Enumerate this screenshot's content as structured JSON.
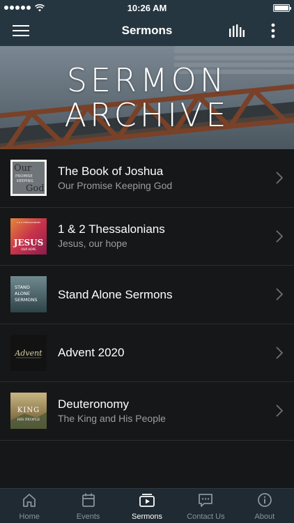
{
  "status_bar": {
    "time": "10:26 AM"
  },
  "nav": {
    "title": "Sermons"
  },
  "banner": {
    "line1": "SERMON",
    "line2": "ARCHIVE"
  },
  "sermons": [
    {
      "title": "The Book of Joshua",
      "subtitle": "Our Promise Keeping God",
      "thumb_text": [
        "Our",
        "PROMISE",
        "KEEPING",
        "God"
      ]
    },
    {
      "title": "1 & 2 Thessalonians",
      "subtitle": "Jesus, our hope",
      "thumb_text": [
        "1 & 2 THESSALONIANS",
        "JESUS",
        "OUR HOPE"
      ]
    },
    {
      "title": "Stand Alone Sermons",
      "subtitle": "",
      "thumb_text": [
        "STAND",
        "ALONE",
        "SERMONS"
      ]
    },
    {
      "title": "Advent 2020",
      "subtitle": "",
      "thumb_text": [
        "Advent"
      ]
    },
    {
      "title": "Deuteronomy",
      "subtitle": "The King and His People",
      "thumb_text": [
        "KING",
        "HIS PEOPLE"
      ]
    }
  ],
  "tabs": [
    {
      "label": "Home",
      "icon": "home-icon",
      "active": false
    },
    {
      "label": "Events",
      "icon": "calendar-icon",
      "active": false
    },
    {
      "label": "Sermons",
      "icon": "play-icon",
      "active": true
    },
    {
      "label": "Contact Us",
      "icon": "chat-icon",
      "active": false
    },
    {
      "label": "About",
      "icon": "info-icon",
      "active": false
    }
  ],
  "colors": {
    "bar": "#263640",
    "background": "#161718",
    "tab_inactive": "#8a949c",
    "subtitle": "#9a9ea3"
  }
}
